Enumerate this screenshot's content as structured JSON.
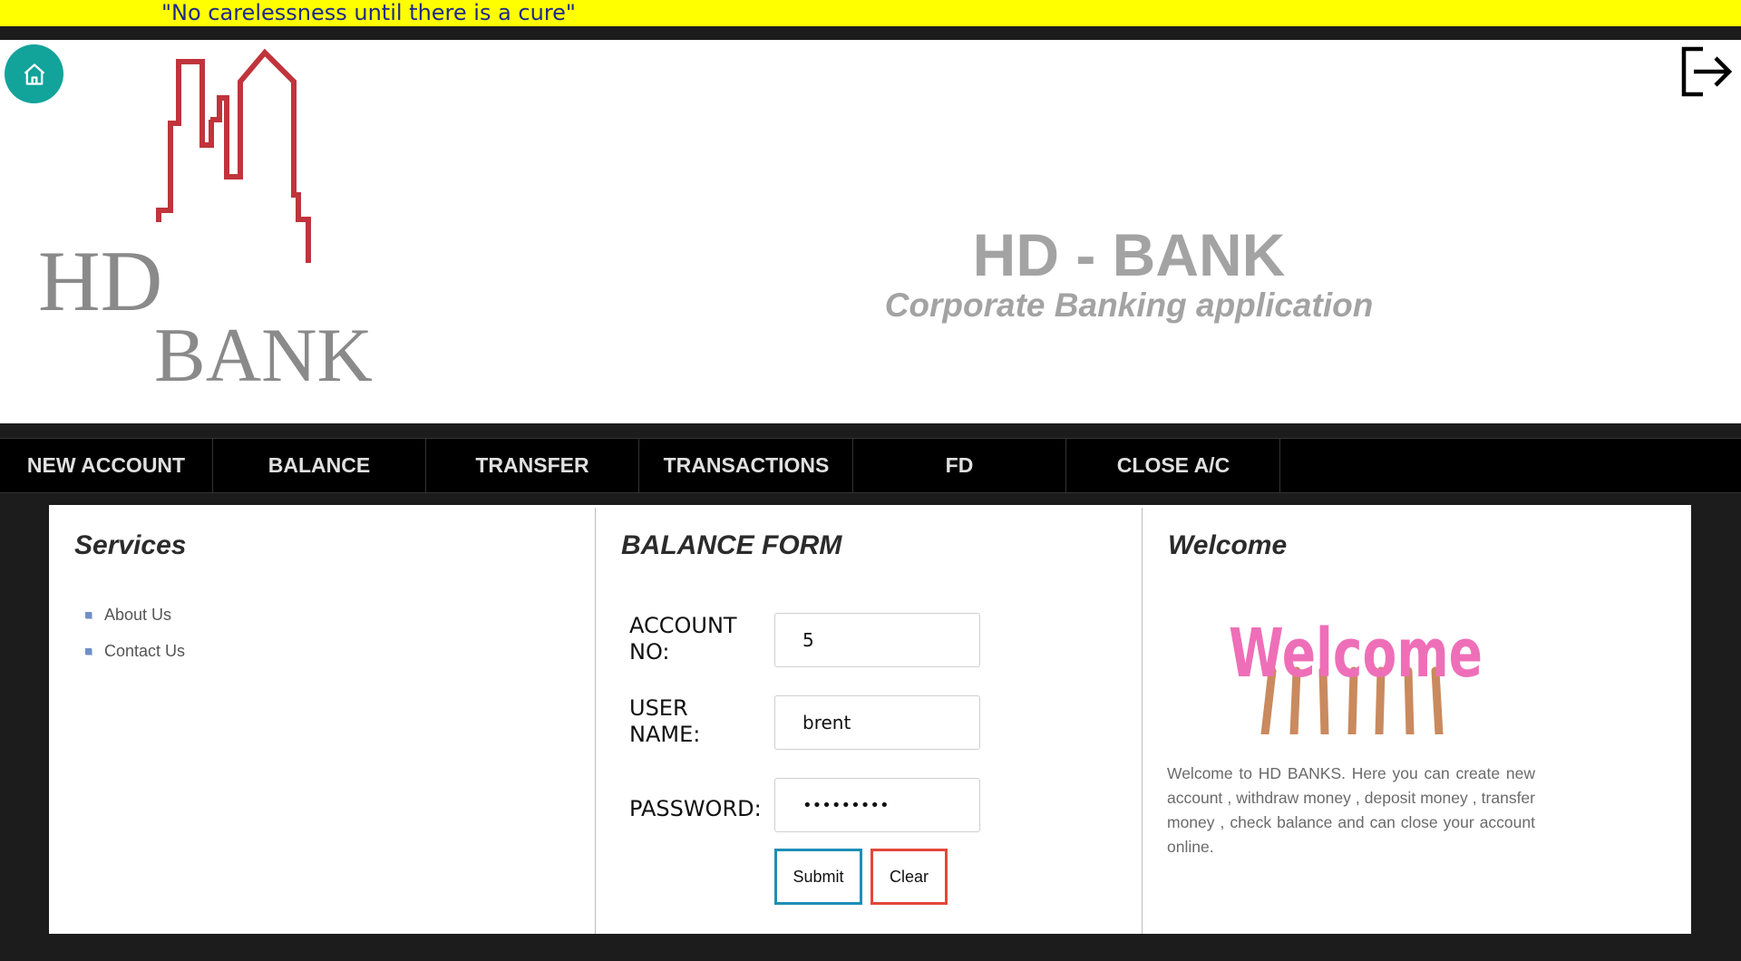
{
  "banner": {
    "quote": "\"No carelessness until there is a cure\""
  },
  "header": {
    "logo_line1": "HD",
    "logo_line2": "BANK",
    "title": "HD - BANK",
    "subtitle": "Corporate Banking application",
    "home_icon": "home-icon",
    "logout_icon": "logout-icon"
  },
  "nav": {
    "items": [
      "NEW ACCOUNT",
      "BALANCE",
      "TRANSFER",
      "TRANSACTIONS",
      "FD",
      "CLOSE A/C"
    ]
  },
  "services": {
    "title": "Services",
    "links": [
      "About Us",
      "Contact Us"
    ]
  },
  "form": {
    "title": "BALANCE FORM",
    "account_label": "ACCOUNT NO:",
    "account_value": "5",
    "username_label": "USER NAME:",
    "username_value": "brent",
    "password_label": "PASSWORD:",
    "password_value": "•••••••••",
    "submit_label": "Submit",
    "clear_label": "Clear"
  },
  "welcome": {
    "title": "Welcome",
    "image_text": "Welcome",
    "body": "Welcome to HD BANKS. Here you can create new account , withdraw money , deposit money , transfer money , check balance and can close your account online."
  },
  "colors": {
    "banner_bg": "#ffff00",
    "home_button": "#12a39b",
    "logo_red": "#c0343c",
    "submit_border": "#1d8fb5",
    "clear_border": "#e3473a"
  }
}
